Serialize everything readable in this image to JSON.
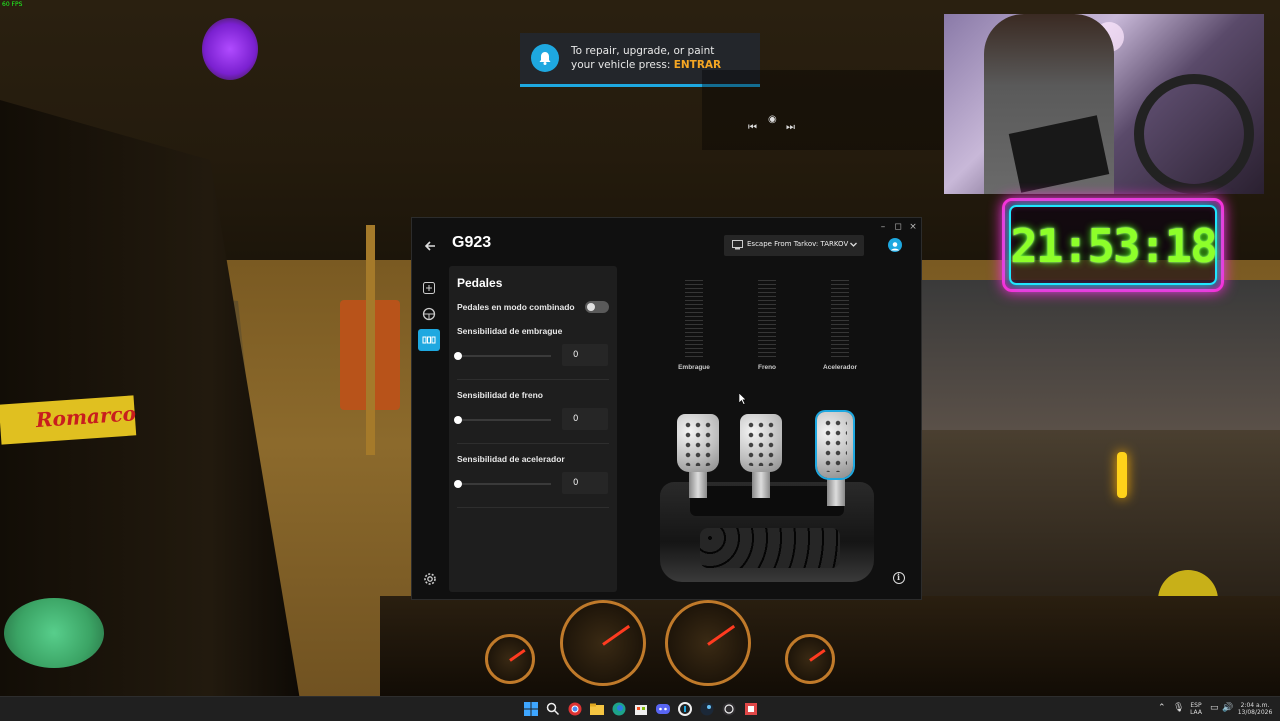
{
  "overlay": {
    "fps_text": "60 FPS"
  },
  "game": {
    "banner_text": "Romarco"
  },
  "toast": {
    "icon": "bell-icon",
    "message_line1": "To repair, upgrade, or paint",
    "message_line2_prefix": "your vehicle press: ",
    "message_key": "ENTRAR",
    "accent_color": "#1ea8e0",
    "key_color": "#f5a623"
  },
  "clock": {
    "time": "21:53:18",
    "glow_color": "#ff2ad9",
    "digit_color": "#8dff2a"
  },
  "ghub": {
    "window_controls": [
      "–",
      "◻",
      "×"
    ],
    "device_name": "G923",
    "profile": {
      "label": "Escape From Tarkov: TARKOV",
      "icon": "game-profile-icon"
    },
    "sidebar": [
      {
        "name": "add-icon",
        "active": false
      },
      {
        "name": "steering-wheel-icon",
        "active": false
      },
      {
        "name": "pedals-icon",
        "active": true
      }
    ],
    "panel": {
      "title": "Pedales",
      "combined_mode_label": "Pedales en modo combinado",
      "combined_mode_on": false,
      "sensitivities": [
        {
          "label": "Sensibilidad de embrague",
          "value": "0"
        },
        {
          "label": "Sensibilidad de freno",
          "value": "0"
        },
        {
          "label": "Sensibilidad de acelerador",
          "value": "0"
        }
      ]
    },
    "meters": [
      {
        "label": "Embrague",
        "level": 0
      },
      {
        "label": "Freno",
        "level": 0
      },
      {
        "label": "Acelerador",
        "level": 0
      }
    ],
    "selected_pedal": "acelerador",
    "accent_color": "#1ea8e0"
  },
  "taskbar": {
    "language": "ESP",
    "layout": "LAA",
    "time": "2:04 a.m.",
    "date": "13/08/2026"
  }
}
